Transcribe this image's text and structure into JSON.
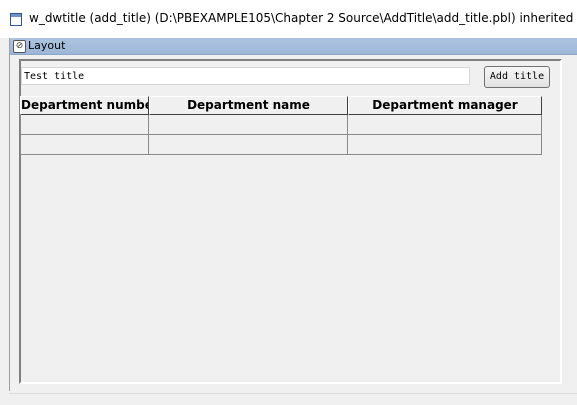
{
  "window": {
    "title": "w_dwtitle (add_title) (D:\\PBEXAMPLE105\\Chapter 2 Source\\AddTitle\\add_title.pbl) inherited from window",
    "icon": "window-icon"
  },
  "layout_pane": {
    "title": "Layout",
    "icon": "layout-icon"
  },
  "form": {
    "title_input_value": "Test title",
    "add_button_label": "Add title"
  },
  "grid": {
    "columns": [
      "Department number",
      "Department name",
      "Department manager"
    ],
    "rows": [
      [
        "",
        "",
        ""
      ],
      [
        "",
        "",
        ""
      ]
    ]
  }
}
